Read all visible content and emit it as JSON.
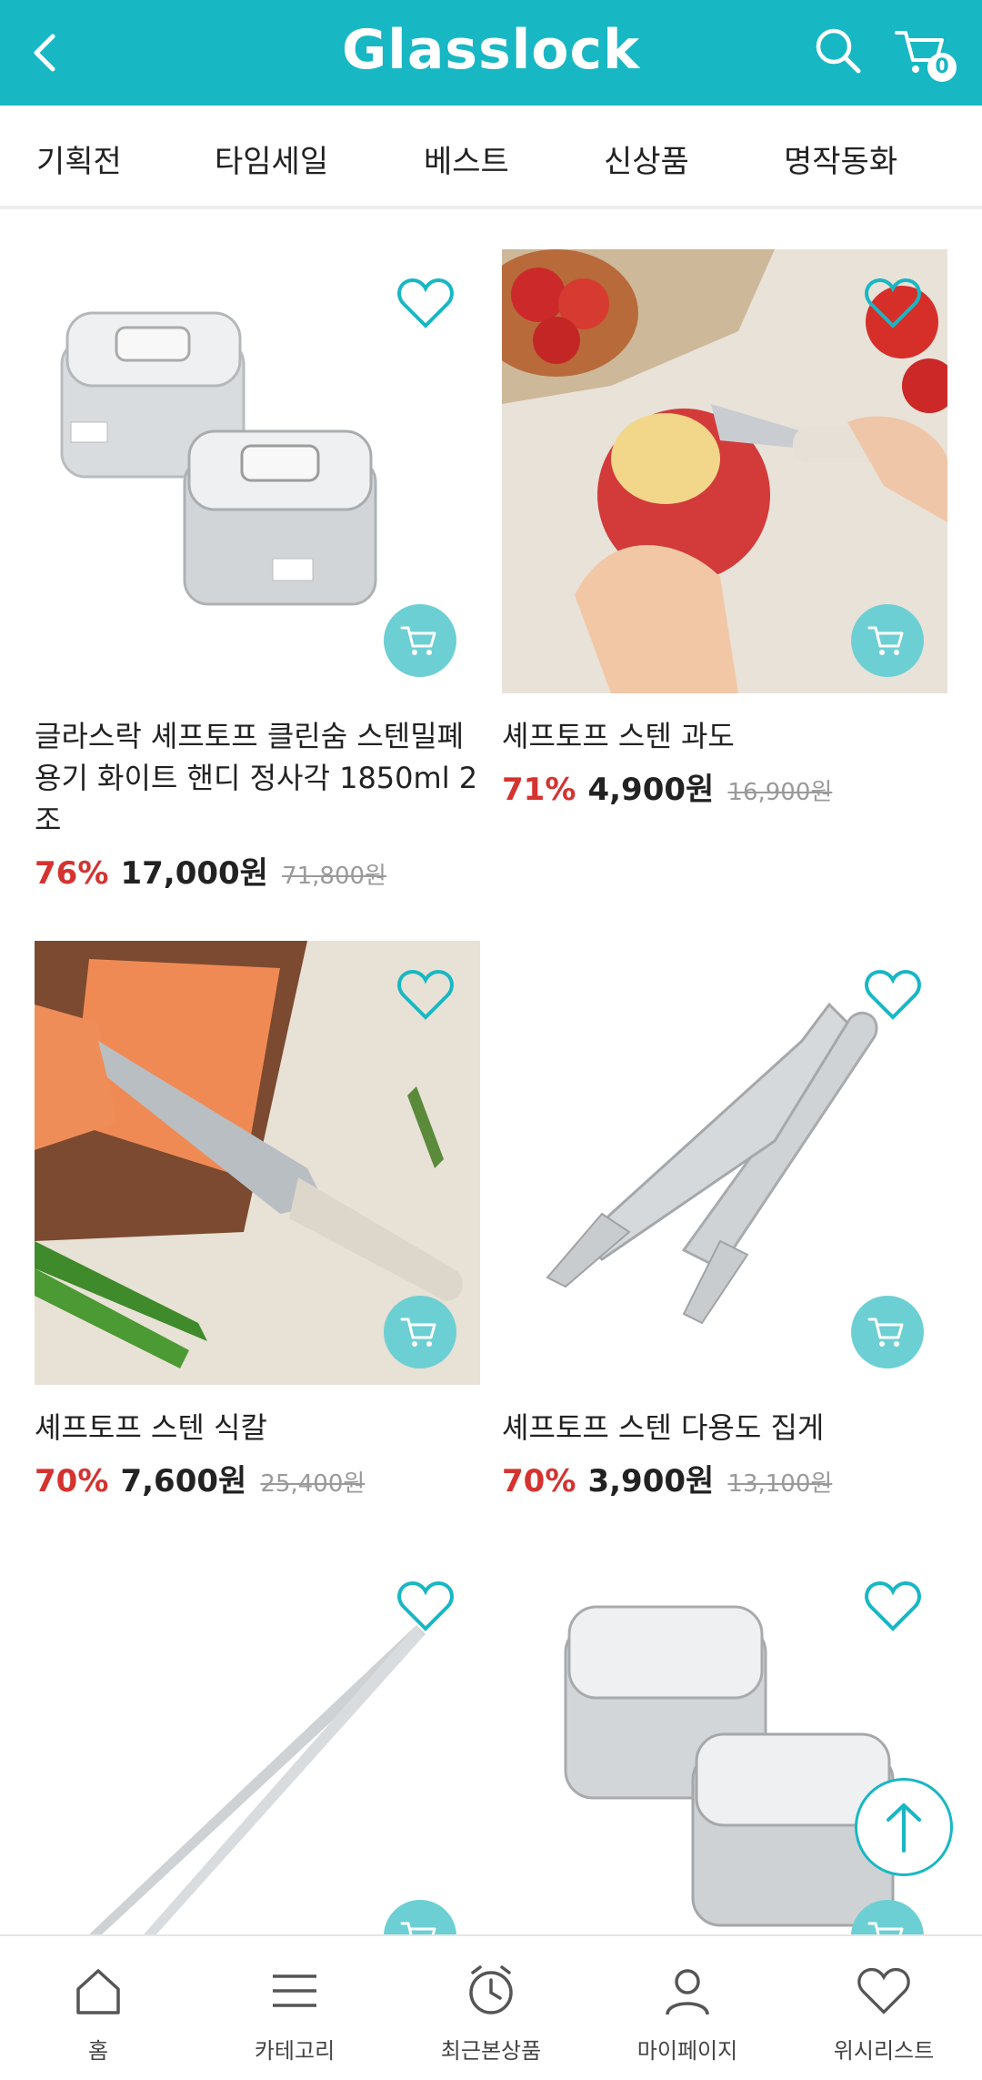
{
  "app": {
    "brand": "Glasslock",
    "cart_count": "0",
    "accent_color": "#18b7c4"
  },
  "tabs": [
    {
      "label": "기획전"
    },
    {
      "label": "타임세일"
    },
    {
      "label": "베스트"
    },
    {
      "label": "신상품"
    },
    {
      "label": "명작동화"
    }
  ],
  "products": [
    {
      "name": "글라스락 셰프토프 클린숨 스텐밀폐용기 화이트 핸디 정사각 1850ml 2조",
      "discount": "76%",
      "price": "17,000원",
      "original": "71,800원",
      "image": "two square steel containers"
    },
    {
      "name": "셰프토프 스텐 과도",
      "discount": "71%",
      "price": "4,900원",
      "original": "16,900원",
      "image": "paring knife with apple"
    },
    {
      "name": "셰프토프 스텐 식칼",
      "discount": "70%",
      "price": "7,600원",
      "original": "25,400원",
      "image": "chef knife with salmon"
    },
    {
      "name": "셰프토프 스텐 다용도 집게",
      "discount": "70%",
      "price": "3,900원",
      "original": "13,100원",
      "image": "steel tongs"
    },
    {
      "name": "",
      "discount": "",
      "price": "",
      "original": "",
      "image": "steel tweezers tongs"
    },
    {
      "name": "",
      "discount": "",
      "price": "",
      "original": "",
      "image": "two small steel containers"
    }
  ],
  "bottom_nav": [
    {
      "label": "홈",
      "icon": "home-icon"
    },
    {
      "label": "카테고리",
      "icon": "menu-icon"
    },
    {
      "label": "최근본상품",
      "icon": "clock-icon"
    },
    {
      "label": "마이페이지",
      "icon": "user-icon"
    },
    {
      "label": "위시리스트",
      "icon": "heart-icon"
    }
  ]
}
